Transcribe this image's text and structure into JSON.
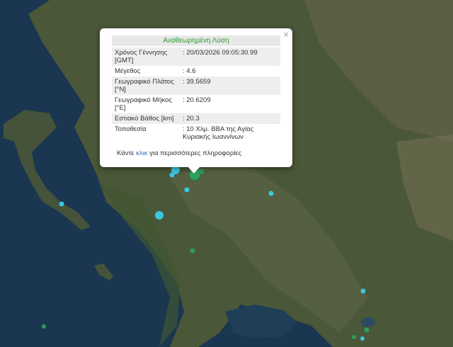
{
  "popup": {
    "title": "Αναθεωρημένη Λύση",
    "close_icon": "×",
    "rows": [
      {
        "label": "Χρόνος Γέννησης [GMT]",
        "value": ": 20/03/2026 09:05:30.99"
      },
      {
        "label": "Μέγεθος",
        "value": ": 4.6"
      },
      {
        "label": "Γεωγραφικό Πλάτος [°N]",
        "value": ": 39.5659"
      },
      {
        "label": "Γεωγραφικό Μήκος [°E]",
        "value": ": 20.6209"
      },
      {
        "label": "Εστιακό Βάθος [km]",
        "value": ": 20.3"
      },
      {
        "label": "Τοποθεσία",
        "value": ": 10 Χλμ. ΒΒΑ της Αγίας Κυριακής Ιωαννίνων"
      }
    ],
    "more_prefix": "Κάντε ",
    "more_link": "κλικ",
    "more_suffix": " για περισσότερες πληροφορίες"
  },
  "colors": {
    "title_text": "#2e9a2e",
    "link": "#2a6fc4",
    "marker_cyan": "#3ac8e0",
    "marker_green": "#2e9e5a"
  }
}
